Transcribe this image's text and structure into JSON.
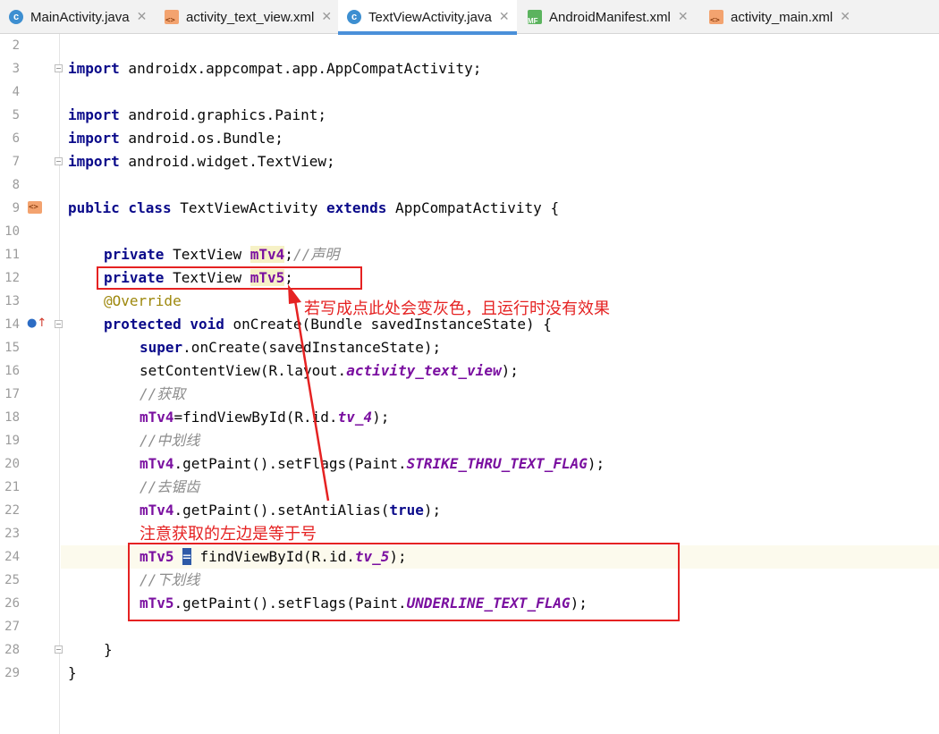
{
  "tabs": [
    {
      "label": "MainActivity.java",
      "icon": "java-class-icon",
      "active": false
    },
    {
      "label": "activity_text_view.xml",
      "icon": "xml-layout-icon",
      "active": false
    },
    {
      "label": "TextViewActivity.java",
      "icon": "java-class-icon",
      "active": true
    },
    {
      "label": "AndroidManifest.xml",
      "icon": "manifest-icon",
      "active": false
    },
    {
      "label": "activity_main.xml",
      "icon": "xml-layout-icon",
      "active": false
    }
  ],
  "close_glyph": "✕",
  "line_numbers": [
    "2",
    "3",
    "4",
    "5",
    "6",
    "7",
    "8",
    "9",
    "10",
    "11",
    "12",
    "13",
    "14",
    "15",
    "16",
    "17",
    "18",
    "19",
    "20",
    "21",
    "22",
    "23",
    "24",
    "25",
    "26",
    "27",
    "28",
    "29"
  ],
  "code": {
    "l3_kw": "import",
    "l3_rest": " androidx.appcompat.app.AppCompatActivity;",
    "l5_kw": "import",
    "l5_rest": " android.graphics.Paint;",
    "l6_kw": "import",
    "l6_rest": " android.os.Bundle;",
    "l7_kw": "import",
    "l7_rest": " android.widget.TextView;",
    "l9_kw1": "public class",
    "l9_name": " TextViewActivity ",
    "l9_kw2": "extends",
    "l9_rest": " AppCompatActivity {",
    "l11_kw": "private",
    "l11_type": " TextView ",
    "l11_field": "mTv4",
    "l11_semi": ";",
    "l11_comment": "//声明",
    "l12_kw": "private",
    "l12_type": " TextView ",
    "l12_field": "mTv5",
    "l12_semi": ";",
    "l13_anno": "@Override",
    "l14_kw": "protected void",
    "l14_rest": " onCreate(Bundle savedInstanceState) {",
    "l15_kw": "super",
    "l15_rest": ".onCreate(savedInstanceState);",
    "l16_pre": "setContentView(R.layout.",
    "l16_const": "activity_text_view",
    "l16_post": ");",
    "l17_comment": "//获取",
    "l18_field": "mTv4",
    "l18_pre": "=findViewById(R.id.",
    "l18_const": "tv_4",
    "l18_post": ");",
    "l19_comment": "//中划线",
    "l20_field": "mTv4",
    "l20_pre": ".getPaint().setFlags(Paint.",
    "l20_const": "STRIKE_THRU_TEXT_FLAG",
    "l20_post": ");",
    "l21_comment": "//去锯齿",
    "l22_field": "mTv4",
    "l22_pre": ".getPaint().setAntiAlias(",
    "l22_kw": "true",
    "l22_post": ");",
    "l24_field": "mTv5",
    "l24_sp": " ",
    "l24_eq": "=",
    "l24_pre": " findViewById(R.id.",
    "l24_const": "tv_5",
    "l24_post": ");",
    "l25_comment": "//下划线",
    "l26_field": "mTv5",
    "l26_pre": ".getPaint().setFlags(Paint.",
    "l26_const": "UNDERLINE_TEXT_FLAG",
    "l26_post": ");",
    "l28_brace": "}",
    "l29_brace": "}"
  },
  "annotations": {
    "note1": "若写成点此处会变灰色，且运行时没有效果",
    "note2": "注意获取的左边是等于号",
    "color": "#e52222"
  },
  "colors": {
    "keyword": "#0a0a8a",
    "field": "#7a0fa0",
    "comment": "#8c8c8c",
    "annotation": "#9e880d",
    "active_tab_underline": "#4a90d9"
  }
}
